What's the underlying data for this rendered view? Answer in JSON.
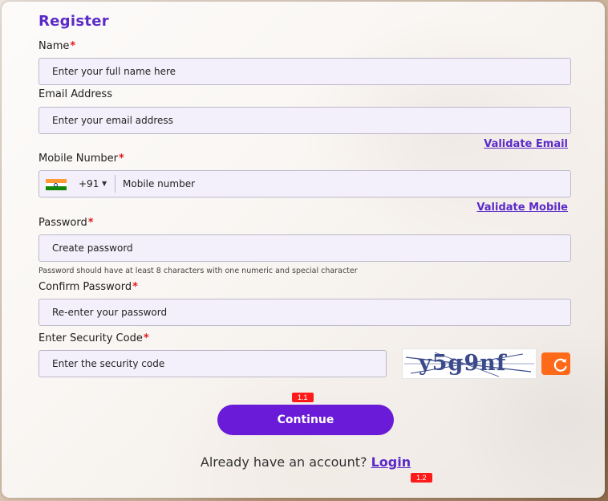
{
  "form": {
    "title": "Register",
    "name": {
      "label": "Name",
      "required_mark": "*",
      "placeholder": "Enter your full name here"
    },
    "email": {
      "label": "Email Address",
      "placeholder": "Enter your email address",
      "validate_link": "Validate Email"
    },
    "mobile": {
      "label": "Mobile Number",
      "required_mark": "*",
      "country_code": "+91",
      "placeholder": "Mobile number",
      "validate_link": "Validate Mobile"
    },
    "password": {
      "label": "Password",
      "required_mark": "*",
      "placeholder": "Create password",
      "hint": "Password should have at least 8 characters with one numeric and special character"
    },
    "confirm_password": {
      "label": "Confirm Password",
      "required_mark": "*",
      "placeholder": "Re-enter your password"
    },
    "security_code": {
      "label": "Enter Security Code",
      "required_mark": "*",
      "placeholder": "Enter the security code",
      "captcha_text": "y5g9nf",
      "refresh_icon": "refresh-icon"
    },
    "continue_label": "Continue",
    "footer": {
      "prompt": "Already have an account?",
      "login_link": "Login"
    }
  },
  "annotations": {
    "continue_badge": "1.1",
    "login_badge": "1.2"
  },
  "colors": {
    "accent": "#5b2bc9",
    "button": "#6a1bd8",
    "required": "#e01c1c",
    "refresh": "#ff6a1a",
    "badge": "#ff1a1a"
  }
}
